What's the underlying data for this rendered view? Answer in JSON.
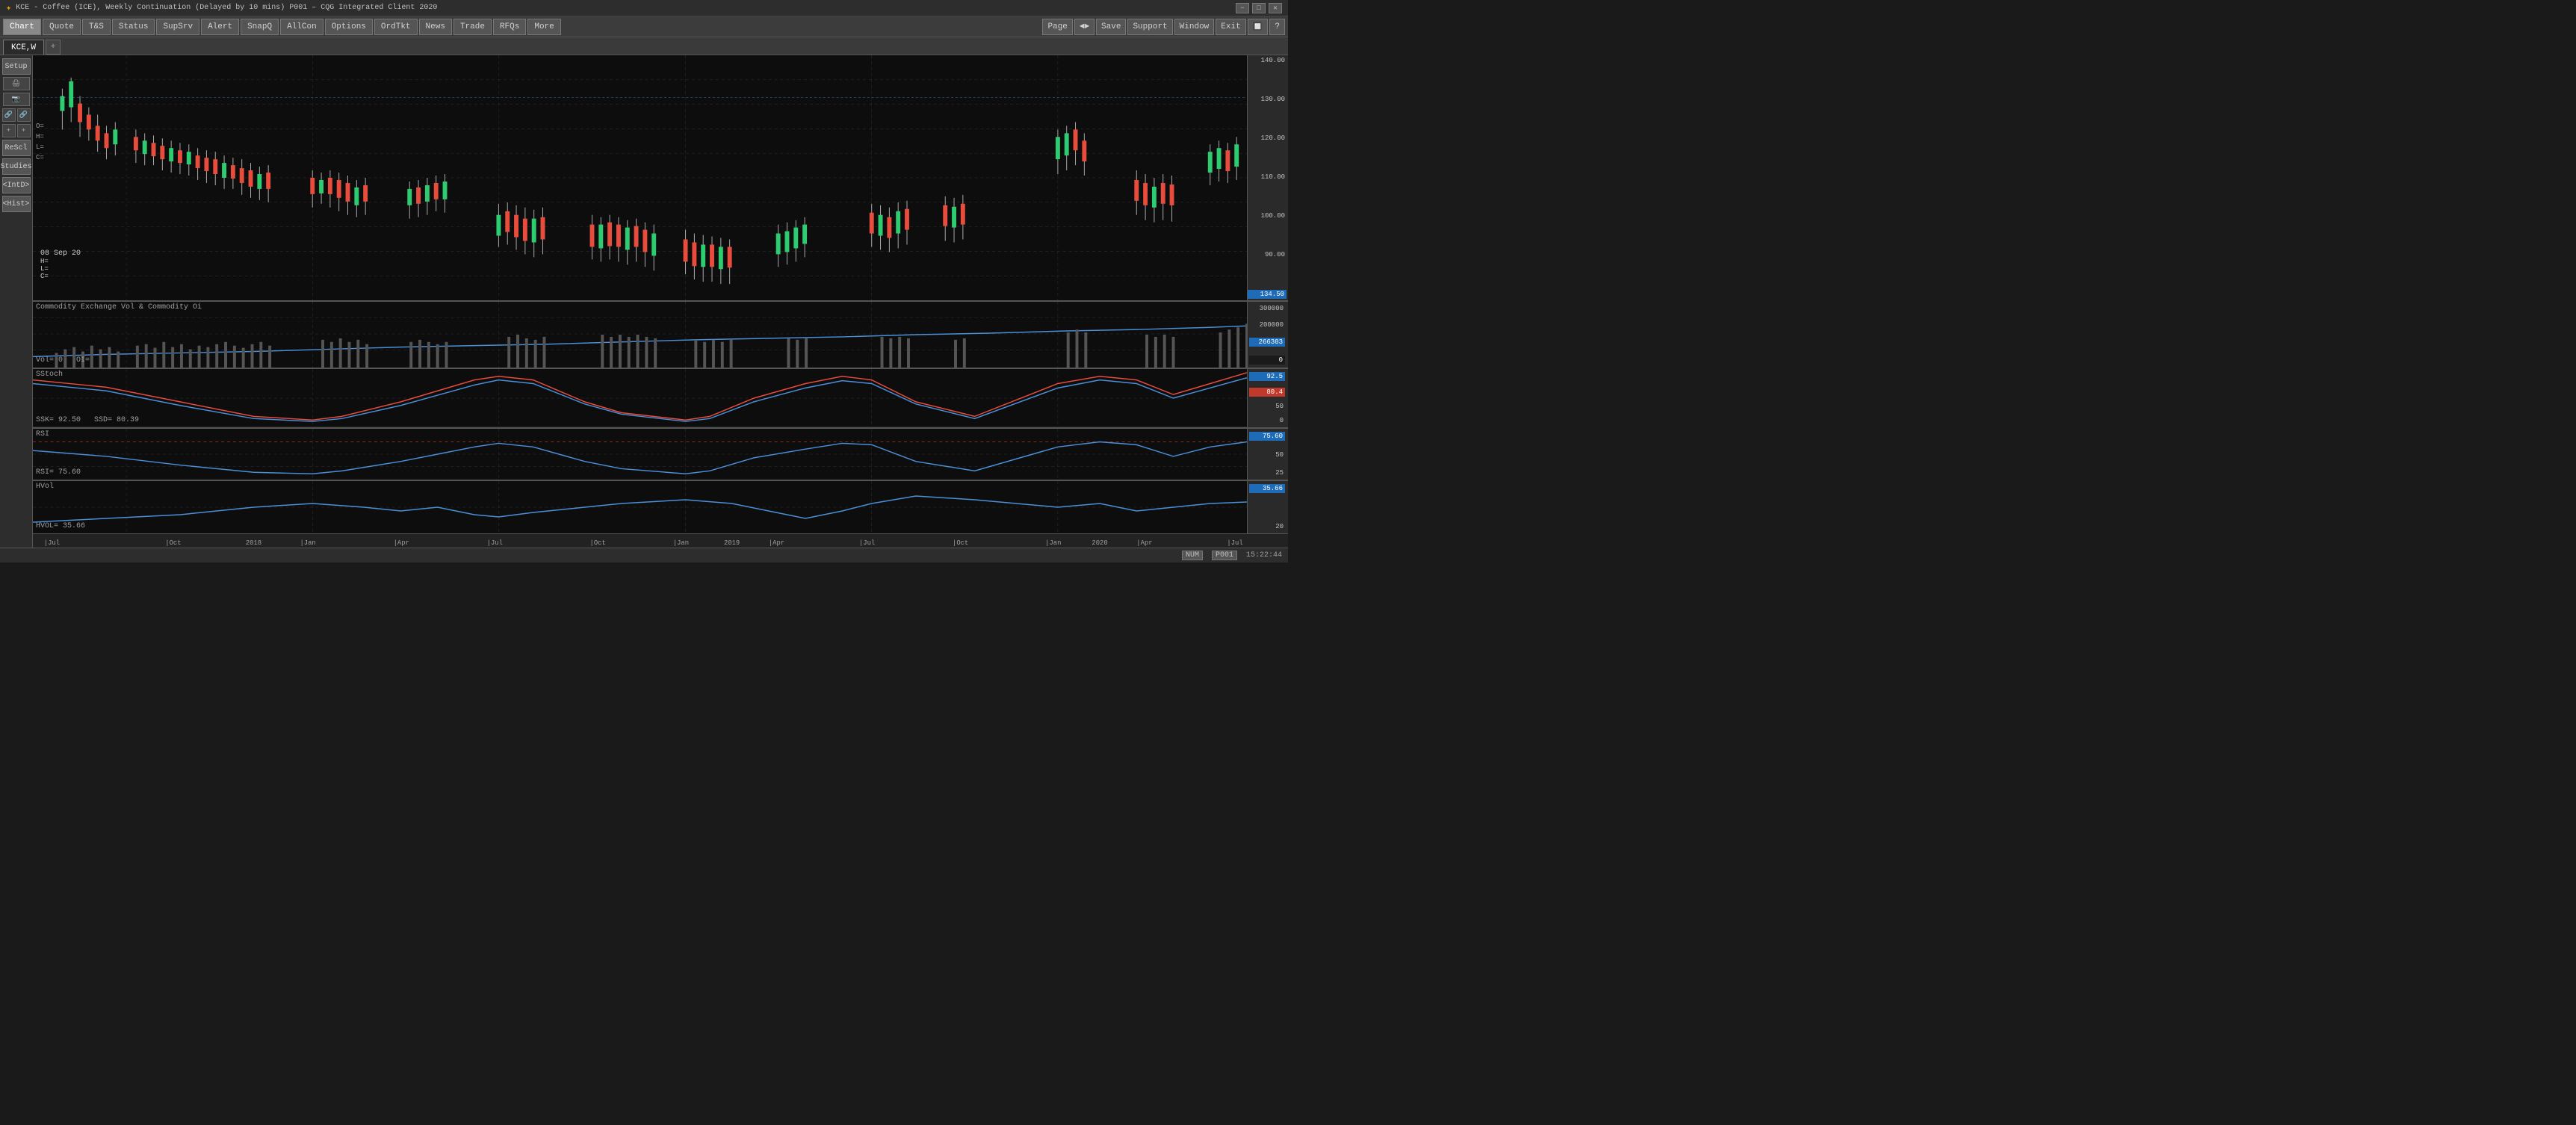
{
  "titlebar": {
    "time": "15:22:44",
    "title": "KCE - Coffee (ICE), Weekly Continuation (Delayed by 10 mins)  P001 – CQG Integrated Client 2020",
    "minimize": "−",
    "maximize": "□",
    "close": "✕"
  },
  "menubar": {
    "left_buttons": [
      "Chart",
      "Quote",
      "T&S",
      "Status",
      "SupSrv",
      "Alert",
      "SnapQ",
      "AllCon",
      "Options",
      "OrdTkt",
      "News",
      "Trade",
      "RFQs",
      "More"
    ],
    "right_buttons": [
      "Page",
      "◄►",
      "Save",
      "Support",
      "Window",
      "Exit",
      "🔲",
      "?"
    ]
  },
  "tabs": {
    "items": [
      "KCE,W"
    ],
    "add_label": "+"
  },
  "sidebar": {
    "setup_label": "Setup",
    "buttons": [
      "ReScl",
      "Studies",
      "<IntD>",
      "<Hist>"
    ]
  },
  "price_panel": {
    "date_label": "08 Sep 20",
    "ohlc": {
      "o": "O=",
      "h": "H=",
      "l": "L=",
      "c": "C="
    },
    "price_levels": [
      "140.00",
      "130.00",
      "120.00",
      "110.00",
      "100.00",
      "90.00"
    ],
    "current_price": "134.50"
  },
  "volume_panel": {
    "label": "Commodity Exchange Vol & Commodity Oi",
    "vol_label": "Vol=",
    "vol_value": "0",
    "oi_label": "OI=",
    "oi_value": "",
    "right_values": [
      "300000",
      "200000"
    ],
    "current_vol": "266303",
    "current_oi": "0"
  },
  "stoch_panel": {
    "label": "SStoch",
    "ssk_label": "SSK=",
    "ssk_value": "92.50",
    "ssd_label": "SSD=",
    "ssd_value": "80.39",
    "levels": [
      "50",
      "0"
    ],
    "current": "92.5",
    "current2": "80.4"
  },
  "rsi_panel": {
    "label": "RSI",
    "rsi_label": "RSI=",
    "rsi_value": "75.60",
    "levels": [
      "50",
      "25"
    ],
    "current": "75.60"
  },
  "hvol_panel": {
    "label": "HVol",
    "hvol_label": "HVOL=",
    "hvol_value": "35.66",
    "levels": [
      "20"
    ],
    "current": "35.66"
  },
  "xaxis": {
    "labels": [
      "Jul",
      "Oct",
      "Jan",
      "Apr",
      "Jul",
      "Oct",
      "Jan",
      "Apr",
      "Jul",
      "Oct",
      "Jan",
      "Apr",
      "Jul"
    ],
    "year_labels": [
      "2018",
      "2019",
      "2020"
    ]
  },
  "statusbar": {
    "num": "NUM",
    "p001": "P001",
    "time": "15:22:44"
  }
}
